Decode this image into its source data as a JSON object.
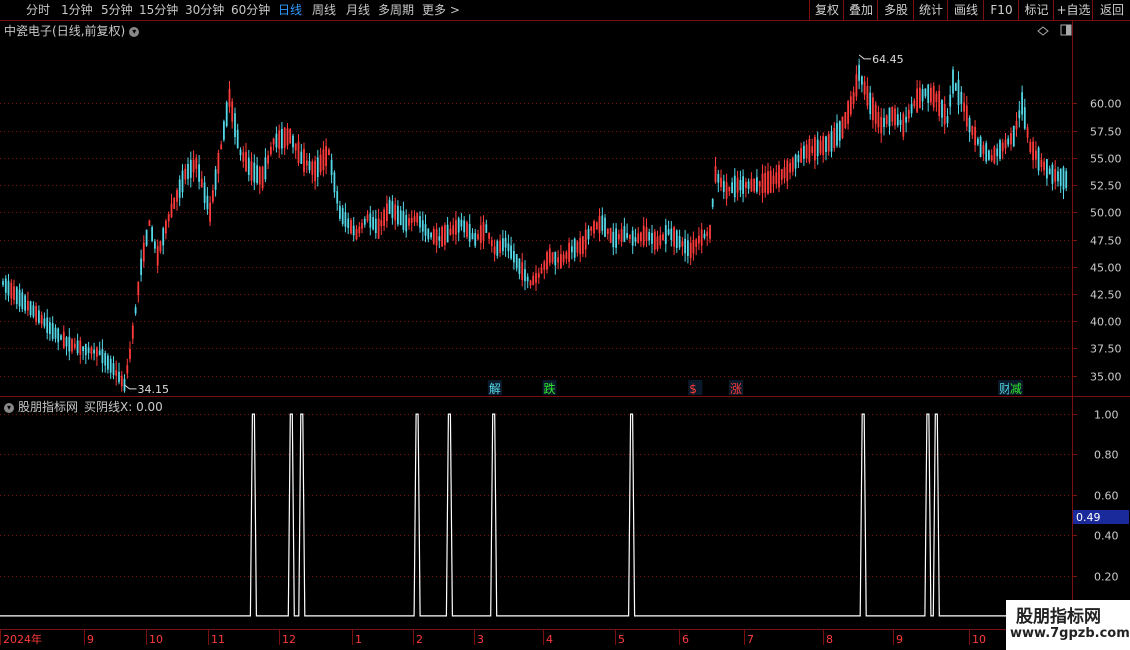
{
  "toolbar": {
    "periods": [
      {
        "label": "分时",
        "active": false
      },
      {
        "label": "1分钟",
        "active": false
      },
      {
        "label": "5分钟",
        "active": false
      },
      {
        "label": "15分钟",
        "active": false
      },
      {
        "label": "30分钟",
        "active": false
      },
      {
        "label": "60分钟",
        "active": false
      },
      {
        "label": "日线",
        "active": true
      },
      {
        "label": "周线",
        "active": false
      },
      {
        "label": "月线",
        "active": false
      },
      {
        "label": "多周期",
        "active": false
      },
      {
        "label": "更多 >",
        "active": false
      }
    ],
    "tools": [
      "复权",
      "叠加",
      "多股",
      "统计",
      "画线",
      "F10",
      "标记",
      "+自选",
      "返回"
    ]
  },
  "stock": {
    "name": "中瓷电子",
    "mode": "(日线,前复权)"
  },
  "indicator": {
    "name": "股朋指标网",
    "line_label": "买阴线X: 0.00",
    "cursor_value": "0.49"
  },
  "watermark": {
    "line1": "股朋指标网",
    "line2": "www.7gpzb.com"
  },
  "colors": {
    "up": "#ff3b3b",
    "down": "#54d8e8",
    "grid": "#7a1010",
    "axis": "#cccccc",
    "pulse": "#ffffff",
    "highlight": "#1b2a9a"
  },
  "chart_data": [
    {
      "type": "candlestick",
      "title": "中瓷电子(日线,前复权)",
      "y_ticks": [
        35.0,
        37.5,
        40.0,
        42.5,
        45.0,
        47.5,
        50.0,
        52.5,
        55.0,
        57.5,
        60.0
      ],
      "ylim": [
        33.5,
        66
      ],
      "x_ticks": [
        "2024年",
        "9",
        "10",
        "11",
        "12",
        "1",
        "2",
        "3",
        "4",
        "5",
        "6",
        "7",
        "8",
        "9",
        "10"
      ],
      "annotations": [
        {
          "text": "64.45",
          "type": "high_marker",
          "value": 64.45
        },
        {
          "text": "34.15",
          "type": "low_marker",
          "value": 34.15
        }
      ],
      "event_tags": [
        {
          "text": "解",
          "color": "#54d8e8",
          "x_frac": 0.456
        },
        {
          "text": "跌",
          "color": "#2ee82e",
          "x_frac": 0.507
        },
        {
          "text": "$",
          "color": "#ff3b3b",
          "x_frac": 0.643
        },
        {
          "text": "涨",
          "color": "#ff3b3b",
          "x_frac": 0.681
        },
        {
          "text": "财",
          "color": "#54d8e8",
          "x_frac": 0.932
        },
        {
          "text": "减",
          "color": "#2ee82e",
          "x_frac": 0.942
        }
      ],
      "anchors": [
        [
          0,
          43.5
        ],
        [
          10,
          41.2
        ],
        [
          18,
          39.1
        ],
        [
          24,
          37.9
        ],
        [
          30,
          37.4
        ],
        [
          35,
          37.1
        ],
        [
          40,
          35.6
        ],
        [
          44,
          34.15
        ],
        [
          46,
          37
        ],
        [
          50,
          45
        ],
        [
          53,
          49
        ],
        [
          56,
          46
        ],
        [
          60,
          49.5
        ],
        [
          66,
          53.5
        ],
        [
          70,
          54.5
        ],
        [
          75,
          50
        ],
        [
          80,
          57.5
        ],
        [
          82,
          60.5
        ],
        [
          86,
          55.5
        ],
        [
          90,
          53.8
        ],
        [
          94,
          53.2
        ],
        [
          98,
          56.5
        ],
        [
          104,
          57
        ],
        [
          108,
          55
        ],
        [
          113,
          53.8
        ],
        [
          118,
          55.5
        ],
        [
          122,
          50
        ],
        [
          128,
          48
        ],
        [
          132,
          49.5
        ],
        [
          136,
          48.5
        ],
        [
          140,
          50.5
        ],
        [
          146,
          49
        ],
        [
          150,
          49.5
        ],
        [
          154,
          48
        ],
        [
          158,
          47.6
        ],
        [
          162,
          48.2
        ],
        [
          166,
          49
        ],
        [
          171,
          47.5
        ],
        [
          175,
          48.5
        ],
        [
          178,
          46.5
        ],
        [
          182,
          47.2
        ],
        [
          186,
          45.5
        ],
        [
          188,
          44.6
        ],
        [
          191,
          43.5
        ],
        [
          194,
          44.2
        ],
        [
          198,
          46
        ],
        [
          202,
          45.5
        ],
        [
          206,
          46.6
        ],
        [
          210,
          47
        ],
        [
          213,
          48.5
        ],
        [
          217,
          49
        ],
        [
          221,
          47.5
        ],
        [
          225,
          48
        ],
        [
          229,
          47.5
        ],
        [
          233,
          48
        ],
        [
          237,
          47.2
        ],
        [
          241,
          48.2
        ],
        [
          245,
          47.3
        ],
        [
          249,
          46.5
        ],
        [
          252,
          47.5
        ],
        [
          256,
          48.2
        ],
        [
          258,
          53.5
        ],
        [
          262,
          52
        ],
        [
          266,
          52.5
        ],
        [
          272,
          52.5
        ],
        [
          278,
          52.8
        ],
        [
          284,
          53.8
        ],
        [
          290,
          55.5
        ],
        [
          296,
          56
        ],
        [
          300,
          56.5
        ],
        [
          304,
          57.8
        ],
        [
          308,
          60.5
        ],
        [
          310,
          62.8
        ],
        [
          314,
          60
        ],
        [
          318,
          58
        ],
        [
          322,
          59
        ],
        [
          326,
          58
        ],
        [
          330,
          60
        ],
        [
          334,
          61
        ],
        [
          338,
          60.5
        ],
        [
          342,
          58.5
        ],
        [
          344,
          62
        ],
        [
          347,
          60.5
        ],
        [
          350,
          58
        ],
        [
          354,
          56
        ],
        [
          358,
          55
        ],
        [
          362,
          56
        ],
        [
          366,
          57
        ],
        [
          369,
          60
        ],
        [
          372,
          56
        ],
        [
          376,
          54.5
        ],
        [
          380,
          53.5
        ],
        [
          385,
          53
        ]
      ],
      "n_bars": 386
    },
    {
      "type": "line",
      "title": "股朋指标网",
      "y_ticks": [
        0.2,
        0.4,
        0.6,
        0.8,
        1.0
      ],
      "ylim": [
        -0.05,
        1.06
      ],
      "values": [
        0,
        1
      ],
      "pulse_positions": [
        0.2364,
        0.2717,
        0.2815,
        0.3891,
        0.4192,
        0.4605,
        0.5892,
        0.8052,
        0.8656,
        0.8734
      ]
    }
  ]
}
